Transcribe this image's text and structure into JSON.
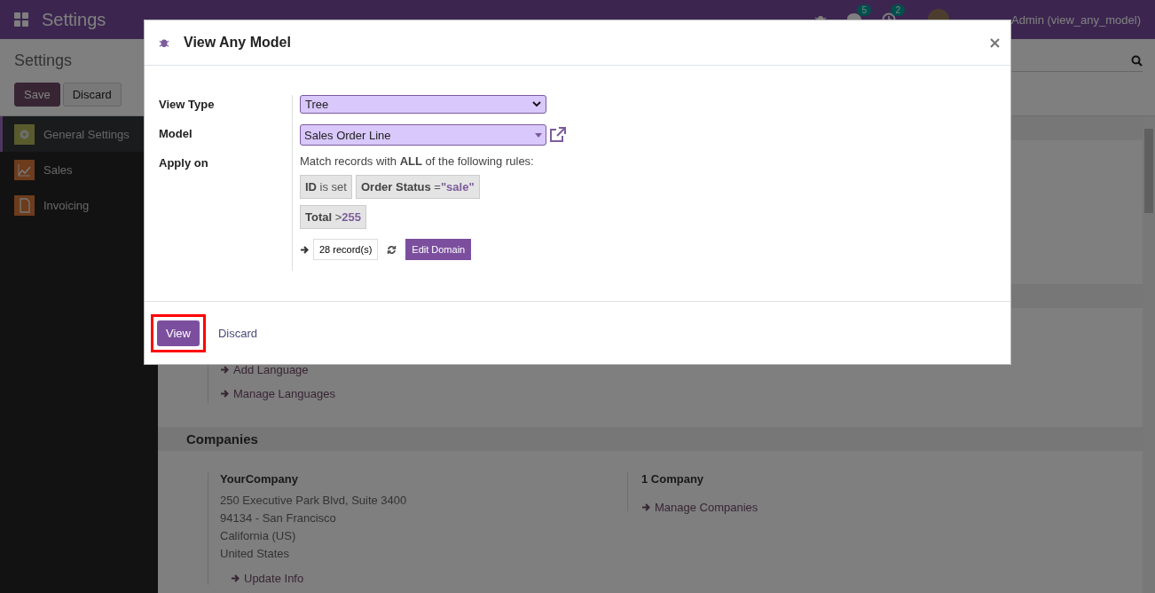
{
  "navbar": {
    "app_title": "Settings",
    "chat_count": "5",
    "activity_count": "2",
    "user": "Admin (view_any_model)"
  },
  "control_panel": {
    "title": "Settings",
    "buttons": [
      {
        "label": "Save",
        "kind": "primary"
      },
      {
        "label": "Discard",
        "kind": "secondary"
      }
    ]
  },
  "sidebar": {
    "items": [
      {
        "label": "General Settings",
        "selected": true,
        "kind": "settings"
      },
      {
        "label": "Sales",
        "selected": false,
        "kind": "sales"
      },
      {
        "label": "Invoicing",
        "selected": false,
        "kind": "invoicing"
      }
    ]
  },
  "languages": {
    "links": [
      "Add Language",
      "Manage Languages"
    ]
  },
  "companies": {
    "title": "Companies",
    "company_name": "YourCompany",
    "address": [
      "250 Executive Park Blvd, Suite 3400",
      "94134 - San Francisco",
      "California (US)",
      "United States"
    ],
    "update_link": "Update Info",
    "count": "1 Company",
    "manage_link": "Manage Companies"
  },
  "dialog": {
    "title": "View Any Model",
    "fields": [
      {
        "label": "View Type",
        "kind": "select",
        "value": "Tree"
      },
      {
        "label": "Model",
        "kind": "many2one",
        "value": "Sales Order Line"
      },
      {
        "label": "Apply on",
        "kind": "domain"
      }
    ],
    "domain": {
      "intro": "Match records with **ALL** of the following rules:",
      "rules": [
        {
          "field": "ID",
          "operator": "is set"
        },
        {
          "field": "Order Status",
          "operator": "=",
          "value": "\"sale\""
        },
        {
          "field": "Total",
          "operator": ">",
          "value": "255"
        }
      ],
      "record_count": "28 record(s)",
      "edit_button": "Edit Domain"
    },
    "buttons": [
      {
        "label": "View",
        "kind": "primary",
        "highlighted": true
      },
      {
        "label": "Discard",
        "kind": "link",
        "highlighted": false
      }
    ]
  }
}
